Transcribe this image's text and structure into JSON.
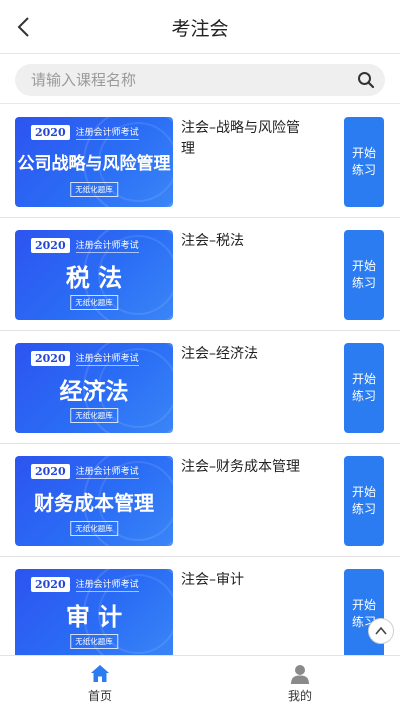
{
  "header": {
    "title": "考注会"
  },
  "search": {
    "placeholder": "请输入课程名称",
    "value": ""
  },
  "thumb_common": {
    "year": "2020",
    "exam": "注册会计师考试",
    "tag": "无纸化题库"
  },
  "courses": [
    {
      "name": "注会–战略与风险管理",
      "thumb_title": "公司战略与风险管理",
      "start": "开始练习"
    },
    {
      "name": "注会–税法",
      "thumb_title": "税 法",
      "start": "开始练习"
    },
    {
      "name": "注会–经济法",
      "thumb_title": "经济法",
      "start": "开始练习"
    },
    {
      "name": "注会–财务成本管理",
      "thumb_title": "财务成本管理",
      "start": "开始练习"
    },
    {
      "name": "注会–审计",
      "thumb_title": "审 计",
      "start": "开始练习"
    }
  ],
  "tabbar": [
    {
      "label": "首页",
      "icon": "home-icon",
      "color": "#2a7cf0"
    },
    {
      "label": "我的",
      "icon": "user-icon",
      "color": "#8a8a8a"
    }
  ],
  "colors": {
    "accent": "#2a7cf0",
    "thumb": "#2d54f0"
  }
}
